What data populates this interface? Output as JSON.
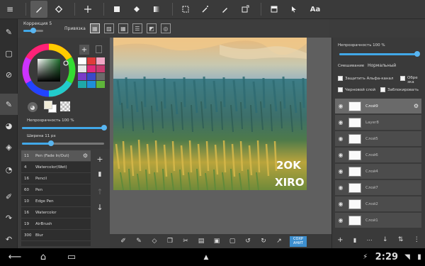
{
  "toolbar": {
    "menu": "≡",
    "font_label": "Aa"
  },
  "subbar": {
    "correction_label": "Коррекция 5",
    "snap_label": "Привязка",
    "correction_value": 0.5
  },
  "colors": {
    "accent": "#41a8e8",
    "swatches": [
      "#ffffff",
      "#e03a3a",
      "#f2a6c4",
      "#e7e7e7",
      "#e0287a",
      "#c73a6f",
      "#7a3cc8",
      "#3a49c9",
      "#6a6a6a",
      "#1fa8a8",
      "#1f8ed8",
      "#5fb53a"
    ]
  },
  "colorpanel": {
    "add_label": "+",
    "opacity_label": "Непрозрачность 100 %",
    "width_label": "Ширина 11 px",
    "opacity_value": 1.0,
    "width_value": 0.35
  },
  "brushes": [
    {
      "size": "11",
      "name": "Pen (Fade In/Out)",
      "selected": true
    },
    {
      "size": "4",
      "name": "Watercolor(Wet)"
    },
    {
      "size": "16",
      "name": "Pencil"
    },
    {
      "size": "60",
      "name": "Pen"
    },
    {
      "size": "10",
      "name": "Edge Pen"
    },
    {
      "size": "16",
      "name": "Watercolor"
    },
    {
      "size": "19",
      "name": "AirBrush"
    },
    {
      "size": "300",
      "name": "Blur"
    }
  ],
  "layers_panel": {
    "opacity_label": "Непрозрачность 100 %",
    "opacity_value": 1.0,
    "blend_label": "Смешивание",
    "blend_value": "Нормальный",
    "protect_alpha": "Защитить Альфа-канал",
    "clip_label": "Обре",
    "clip_label2": "зка",
    "draft_label": "Черновой слой",
    "lock_label": "Заблокировать"
  },
  "layers": [
    {
      "name": "Слой9",
      "selected": true
    },
    {
      "name": "Layer8"
    },
    {
      "name": "Слой5"
    },
    {
      "name": "Слой6"
    },
    {
      "name": "Слой4"
    },
    {
      "name": "Слой7"
    },
    {
      "name": "Слой2"
    },
    {
      "name": "Слой1"
    }
  ],
  "bottombar": {
    "save_label_1": "СОХР",
    "save_label_2": "АНИТ"
  },
  "canvas": {
    "signature_line1": "2OK",
    "signature_line2": "XIRO"
  },
  "status": {
    "time": "2:29"
  }
}
